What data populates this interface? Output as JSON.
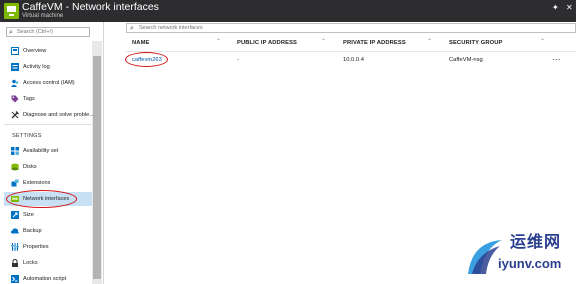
{
  "header": {
    "title": "CaffeVM - Network interfaces",
    "subtitle": "Virtual machine",
    "pin": "✦",
    "close": "✕"
  },
  "sidebar": {
    "search_placeholder": "Search (Ctrl+/)",
    "items": [
      {
        "label": "Overview",
        "icon": "overview-icon",
        "color": "#0072c6"
      },
      {
        "label": "Activity log",
        "icon": "activity-log-icon",
        "color": "#0072c6"
      },
      {
        "label": "Access control (IAM)",
        "icon": "access-control-icon",
        "color": "#0072c6"
      },
      {
        "label": "Tags",
        "icon": "tags-icon",
        "color": "#7b3f98"
      },
      {
        "label": "Diagnose and solve proble...",
        "icon": "diagnose-icon",
        "color": "#333333"
      }
    ],
    "section_title": "SETTINGS",
    "settings_items": [
      {
        "label": "Availability set",
        "icon": "availability-set-icon",
        "color": "#0072c6"
      },
      {
        "label": "Disks",
        "icon": "disks-icon",
        "color": "#7fba00"
      },
      {
        "label": "Extensions",
        "icon": "extensions-icon",
        "color": "#0072c6"
      },
      {
        "label": "Network interfaces",
        "icon": "network-interfaces-icon",
        "color": "#7fba00",
        "active": true
      },
      {
        "label": "Size",
        "icon": "size-icon",
        "color": "#0072c6"
      },
      {
        "label": "Backup",
        "icon": "backup-icon",
        "color": "#0072c6"
      },
      {
        "label": "Properties",
        "icon": "properties-icon",
        "color": "#0072c6"
      },
      {
        "label": "Locks",
        "icon": "locks-icon",
        "color": "#333333"
      },
      {
        "label": "Automation script",
        "icon": "automation-script-icon",
        "color": "#0072c6"
      }
    ]
  },
  "main": {
    "search_placeholder": "Search network interfaces",
    "columns": [
      "NAME",
      "PUBLIC IP ADDRESS",
      "PRIVATE IP ADDRESS",
      "SECURITY GROUP"
    ],
    "rows": [
      {
        "name": "caffevm263",
        "public_ip": "-",
        "private_ip": "10.0.0.4",
        "security_group": "CaffeVM-nsg",
        "more": "..."
      }
    ]
  },
  "watermark": {
    "brand": "运维网",
    "site": "iyunv.com"
  },
  "colors": {
    "header_bg": "#2d2d30",
    "accent": "#0072c6",
    "active_bg": "#c7e0f4",
    "annotation": "#d21313"
  }
}
